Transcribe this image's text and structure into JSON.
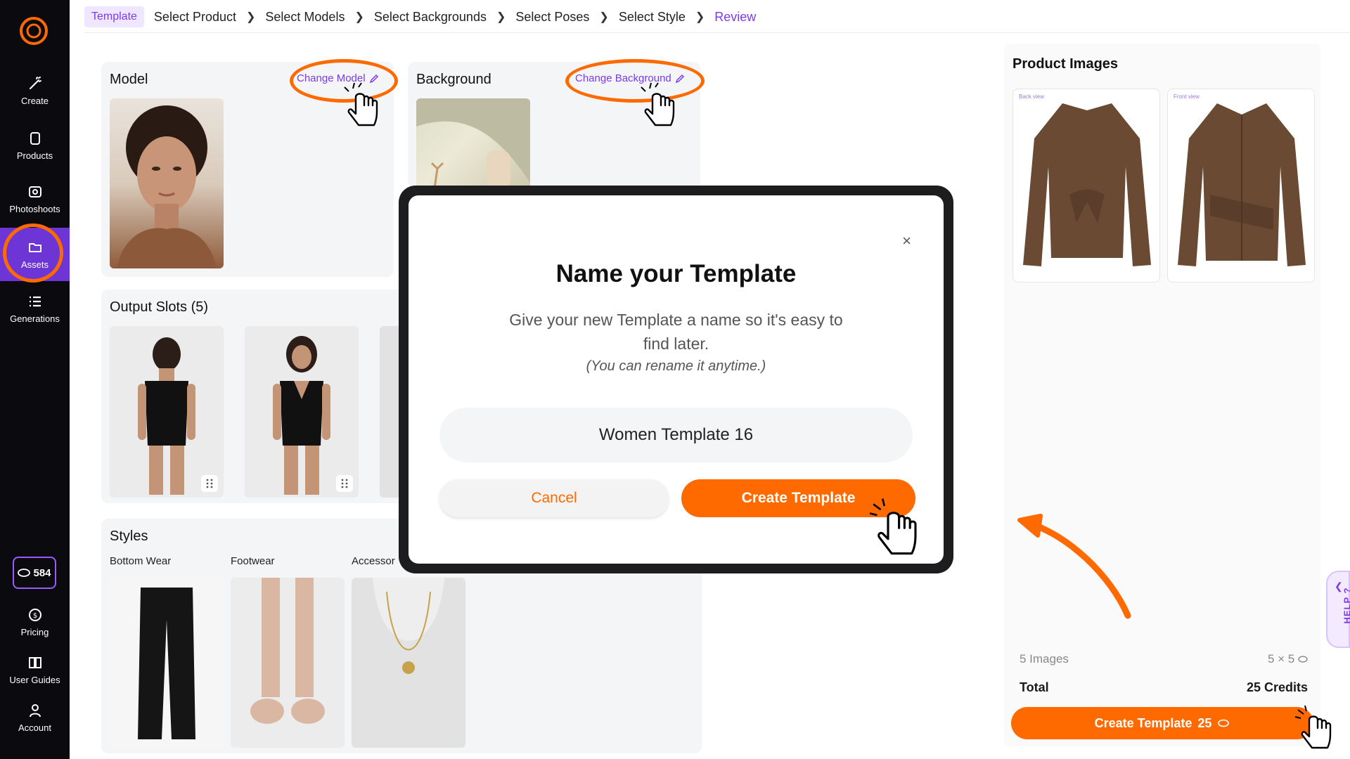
{
  "breadcrumb": {
    "items": [
      "Template",
      "Select Product",
      "Select Models",
      "Select Backgrounds",
      "Select Poses",
      "Select Style",
      "Review"
    ]
  },
  "sidebar": {
    "items": [
      {
        "label": "Create",
        "icon": "wand-icon"
      },
      {
        "label": "Products",
        "icon": "shirt-icon"
      },
      {
        "label": "Photoshoots",
        "icon": "camera-icon"
      },
      {
        "label": "Assets",
        "icon": "folder-icon"
      },
      {
        "label": "Generations",
        "icon": "list-icon"
      }
    ],
    "credits": "584",
    "bottom_items": [
      {
        "label": "Pricing",
        "icon": "dollar-icon"
      },
      {
        "label": "User Guides",
        "icon": "book-icon"
      },
      {
        "label": "Account",
        "icon": "user-icon"
      }
    ]
  },
  "model_panel": {
    "title": "Model",
    "change_label": "Change Model"
  },
  "background_panel": {
    "title": "Background",
    "change_label": "Change Background"
  },
  "output_panel": {
    "title": "Output Slots (5)"
  },
  "styles_panel": {
    "title": "Styles",
    "categories": [
      "Bottom Wear",
      "Footwear",
      "Accessor"
    ]
  },
  "modal": {
    "title": "Name your Template",
    "description": "Give your new Template a name so it's easy to find later.",
    "note": "(You can rename it anytime.)",
    "input_value": "Women Template 16",
    "cancel_label": "Cancel",
    "create_label": "Create Template",
    "close_label": "×"
  },
  "summary": {
    "title": "Product Images",
    "card_tags": [
      "Back view",
      "Front view"
    ],
    "images_count": "5 Images",
    "images_calc": "5 × 5",
    "total_label": "Total",
    "total_value": "25 Credits",
    "button_label": "Create Template",
    "button_credits": "25"
  },
  "help": {
    "label": "HELP ?"
  },
  "colors": {
    "accent": "#ff6a00",
    "brand": "#7c3aed",
    "sidebar_bg": "#0b0b0f"
  }
}
